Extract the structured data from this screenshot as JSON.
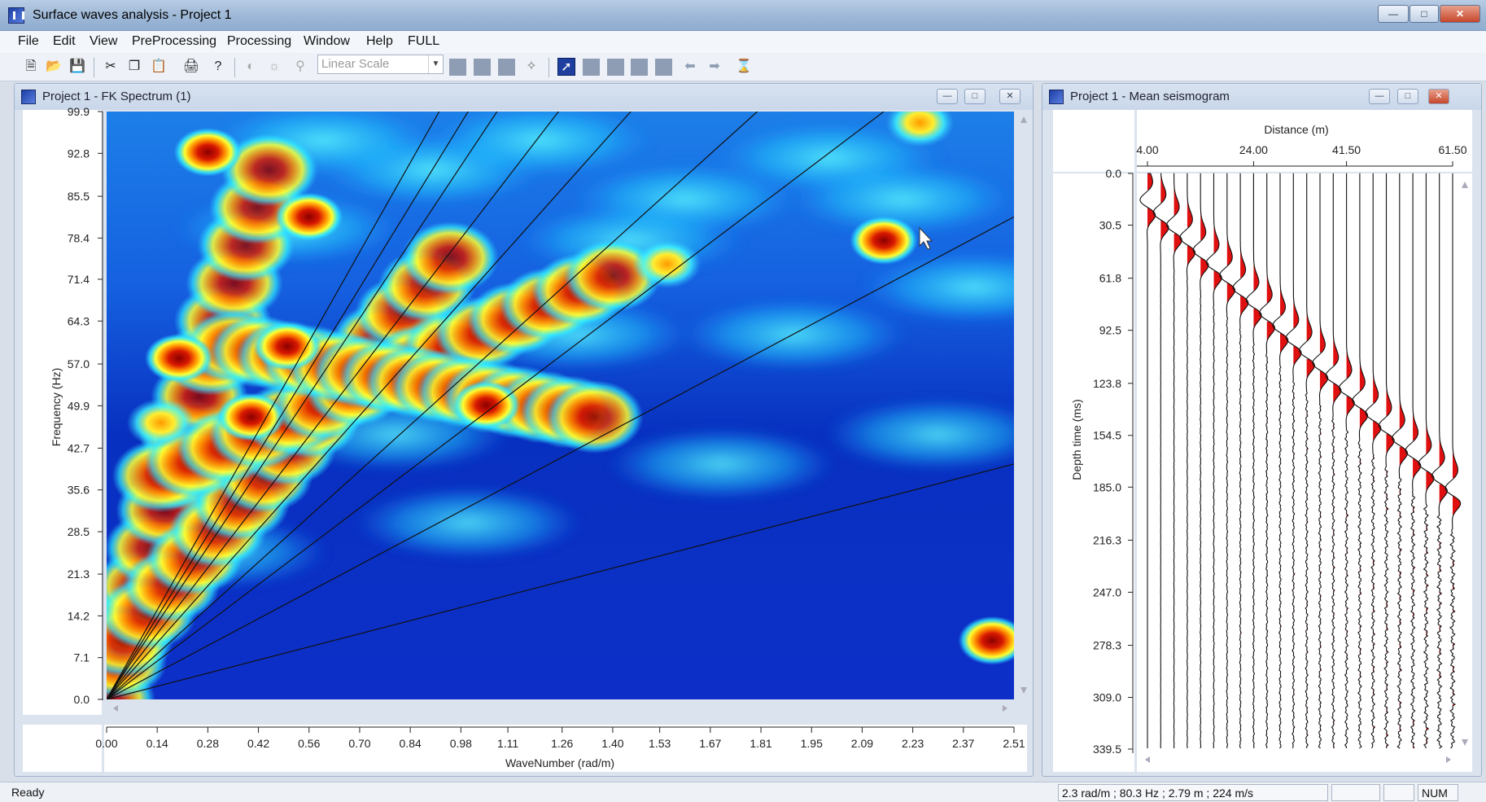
{
  "window": {
    "title": "Surface waves analysis - Project 1"
  },
  "menu": [
    "File",
    "Edit",
    "View",
    "PreProcessing",
    "Processing",
    "Window",
    "Help",
    "FULL"
  ],
  "toolbar": {
    "scale_select": "Linear Scale"
  },
  "fk_window": {
    "title": "Project 1 - FK Spectrum (1)",
    "y_axis_label": "Frequency (Hz)",
    "x_axis_label": "WaveNumber (rad/m)",
    "y_ticks": [
      "99.9",
      "92.8",
      "85.5",
      "78.4",
      "71.4",
      "64.3",
      "57.0",
      "49.9",
      "42.7",
      "35.6",
      "28.5",
      "21.3",
      "14.2",
      "7.1",
      "0.0"
    ],
    "x_ticks": [
      "0.00",
      "0.14",
      "0.28",
      "0.42",
      "0.56",
      "0.70",
      "0.84",
      "0.98",
      "1.11",
      "1.26",
      "1.40",
      "1.53",
      "1.67",
      "1.81",
      "1.95",
      "2.09",
      "2.23",
      "2.37",
      "2.51"
    ]
  },
  "seis_window": {
    "title": "Project 1 - Mean seismogram",
    "top_axis_label": "Distance (m)",
    "top_ticks": [
      "4.00",
      "24.00",
      "41.50",
      "61.50"
    ],
    "y_axis_label": "Depth time (ms)",
    "y_ticks": [
      "0.0",
      "30.5",
      "61.8",
      "92.5",
      "123.8",
      "154.5",
      "185.0",
      "216.3",
      "247.0",
      "278.3",
      "309.0",
      "339.5"
    ]
  },
  "status": {
    "left": "Ready",
    "readout": "2.3 rad/m ; 80.3 Hz ; 2.79 m ; 224 m/s",
    "num": "NUM"
  },
  "colors": {
    "jet_low": "#00008f",
    "jet_mid": "#00ffff",
    "jet_high": "#800000",
    "wiggle_fill": "#e01010"
  },
  "chart_data": [
    {
      "type": "heatmap",
      "title": "",
      "xlabel": "WaveNumber (rad/m)",
      "ylabel": "Frequency (Hz)",
      "xlim": [
        0,
        2.51
      ],
      "ylim": [
        0,
        99.9
      ],
      "colormap": "jet",
      "velocity_lines_from_origin": true,
      "velocity_line_endpoints": [
        [
          0.92,
          99.9
        ],
        [
          1.0,
          99.9
        ],
        [
          1.08,
          99.9
        ],
        [
          1.25,
          99.9
        ],
        [
          1.45,
          99.9
        ],
        [
          1.8,
          99.9
        ],
        [
          2.15,
          99.9
        ],
        [
          2.51,
          82
        ],
        [
          2.51,
          40
        ]
      ],
      "hot_ridges": [
        {
          "from": [
            0,
            0
          ],
          "to": [
            0.45,
            90
          ],
          "width": 0.04
        },
        {
          "from": [
            0.05,
            10
          ],
          "to": [
            0.95,
            75
          ],
          "width": 0.05
        },
        {
          "from": [
            0.15,
            38
          ],
          "to": [
            1.4,
            72
          ],
          "width": 0.05
        },
        {
          "from": [
            0.35,
            60
          ],
          "to": [
            1.35,
            48
          ],
          "width": 0.05
        }
      ],
      "hot_blobs": [
        [
          0.28,
          93
        ],
        [
          0.2,
          58
        ],
        [
          0.15,
          47
        ],
        [
          0.56,
          82
        ],
        [
          0.5,
          60
        ],
        [
          1.55,
          74
        ],
        [
          1.05,
          50
        ],
        [
          2.15,
          78
        ],
        [
          2.25,
          98
        ],
        [
          2.45,
          10
        ],
        [
          0.4,
          48
        ]
      ]
    },
    {
      "type": "line",
      "title": "",
      "xlabel": "Distance (m)",
      "ylabel": "Depth time (ms)",
      "xlim": [
        4,
        61.5
      ],
      "ylim": [
        0,
        339.5
      ],
      "trace_count": 24,
      "first_arrival": [
        [
          4,
          20
        ],
        [
          61.5,
          190
        ]
      ]
    }
  ]
}
